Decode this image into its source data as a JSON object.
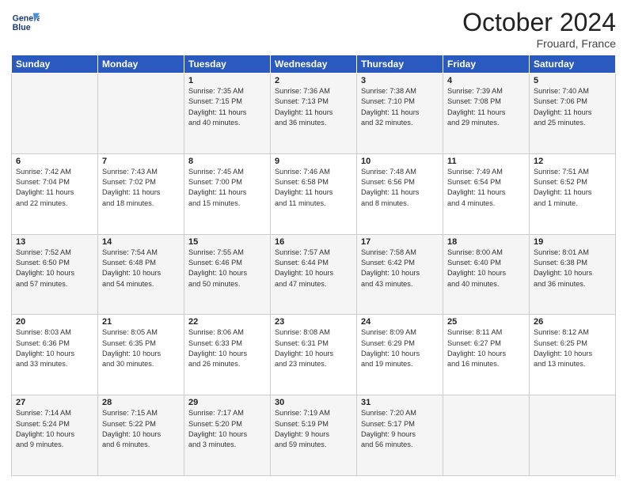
{
  "header": {
    "logo_line1": "General",
    "logo_line2": "Blue",
    "month": "October 2024",
    "location": "Frouard, France"
  },
  "weekdays": [
    "Sunday",
    "Monday",
    "Tuesday",
    "Wednesday",
    "Thursday",
    "Friday",
    "Saturday"
  ],
  "weeks": [
    [
      {
        "day": "",
        "info": ""
      },
      {
        "day": "",
        "info": ""
      },
      {
        "day": "1",
        "info": "Sunrise: 7:35 AM\nSunset: 7:15 PM\nDaylight: 11 hours\nand 40 minutes."
      },
      {
        "day": "2",
        "info": "Sunrise: 7:36 AM\nSunset: 7:13 PM\nDaylight: 11 hours\nand 36 minutes."
      },
      {
        "day": "3",
        "info": "Sunrise: 7:38 AM\nSunset: 7:10 PM\nDaylight: 11 hours\nand 32 minutes."
      },
      {
        "day": "4",
        "info": "Sunrise: 7:39 AM\nSunset: 7:08 PM\nDaylight: 11 hours\nand 29 minutes."
      },
      {
        "day": "5",
        "info": "Sunrise: 7:40 AM\nSunset: 7:06 PM\nDaylight: 11 hours\nand 25 minutes."
      }
    ],
    [
      {
        "day": "6",
        "info": "Sunrise: 7:42 AM\nSunset: 7:04 PM\nDaylight: 11 hours\nand 22 minutes."
      },
      {
        "day": "7",
        "info": "Sunrise: 7:43 AM\nSunset: 7:02 PM\nDaylight: 11 hours\nand 18 minutes."
      },
      {
        "day": "8",
        "info": "Sunrise: 7:45 AM\nSunset: 7:00 PM\nDaylight: 11 hours\nand 15 minutes."
      },
      {
        "day": "9",
        "info": "Sunrise: 7:46 AM\nSunset: 6:58 PM\nDaylight: 11 hours\nand 11 minutes."
      },
      {
        "day": "10",
        "info": "Sunrise: 7:48 AM\nSunset: 6:56 PM\nDaylight: 11 hours\nand 8 minutes."
      },
      {
        "day": "11",
        "info": "Sunrise: 7:49 AM\nSunset: 6:54 PM\nDaylight: 11 hours\nand 4 minutes."
      },
      {
        "day": "12",
        "info": "Sunrise: 7:51 AM\nSunset: 6:52 PM\nDaylight: 11 hours\nand 1 minute."
      }
    ],
    [
      {
        "day": "13",
        "info": "Sunrise: 7:52 AM\nSunset: 6:50 PM\nDaylight: 10 hours\nand 57 minutes."
      },
      {
        "day": "14",
        "info": "Sunrise: 7:54 AM\nSunset: 6:48 PM\nDaylight: 10 hours\nand 54 minutes."
      },
      {
        "day": "15",
        "info": "Sunrise: 7:55 AM\nSunset: 6:46 PM\nDaylight: 10 hours\nand 50 minutes."
      },
      {
        "day": "16",
        "info": "Sunrise: 7:57 AM\nSunset: 6:44 PM\nDaylight: 10 hours\nand 47 minutes."
      },
      {
        "day": "17",
        "info": "Sunrise: 7:58 AM\nSunset: 6:42 PM\nDaylight: 10 hours\nand 43 minutes."
      },
      {
        "day": "18",
        "info": "Sunrise: 8:00 AM\nSunset: 6:40 PM\nDaylight: 10 hours\nand 40 minutes."
      },
      {
        "day": "19",
        "info": "Sunrise: 8:01 AM\nSunset: 6:38 PM\nDaylight: 10 hours\nand 36 minutes."
      }
    ],
    [
      {
        "day": "20",
        "info": "Sunrise: 8:03 AM\nSunset: 6:36 PM\nDaylight: 10 hours\nand 33 minutes."
      },
      {
        "day": "21",
        "info": "Sunrise: 8:05 AM\nSunset: 6:35 PM\nDaylight: 10 hours\nand 30 minutes."
      },
      {
        "day": "22",
        "info": "Sunrise: 8:06 AM\nSunset: 6:33 PM\nDaylight: 10 hours\nand 26 minutes."
      },
      {
        "day": "23",
        "info": "Sunrise: 8:08 AM\nSunset: 6:31 PM\nDaylight: 10 hours\nand 23 minutes."
      },
      {
        "day": "24",
        "info": "Sunrise: 8:09 AM\nSunset: 6:29 PM\nDaylight: 10 hours\nand 19 minutes."
      },
      {
        "day": "25",
        "info": "Sunrise: 8:11 AM\nSunset: 6:27 PM\nDaylight: 10 hours\nand 16 minutes."
      },
      {
        "day": "26",
        "info": "Sunrise: 8:12 AM\nSunset: 6:25 PM\nDaylight: 10 hours\nand 13 minutes."
      }
    ],
    [
      {
        "day": "27",
        "info": "Sunrise: 7:14 AM\nSunset: 5:24 PM\nDaylight: 10 hours\nand 9 minutes."
      },
      {
        "day": "28",
        "info": "Sunrise: 7:15 AM\nSunset: 5:22 PM\nDaylight: 10 hours\nand 6 minutes."
      },
      {
        "day": "29",
        "info": "Sunrise: 7:17 AM\nSunset: 5:20 PM\nDaylight: 10 hours\nand 3 minutes."
      },
      {
        "day": "30",
        "info": "Sunrise: 7:19 AM\nSunset: 5:19 PM\nDaylight: 9 hours\nand 59 minutes."
      },
      {
        "day": "31",
        "info": "Sunrise: 7:20 AM\nSunset: 5:17 PM\nDaylight: 9 hours\nand 56 minutes."
      },
      {
        "day": "",
        "info": ""
      },
      {
        "day": "",
        "info": ""
      }
    ]
  ]
}
